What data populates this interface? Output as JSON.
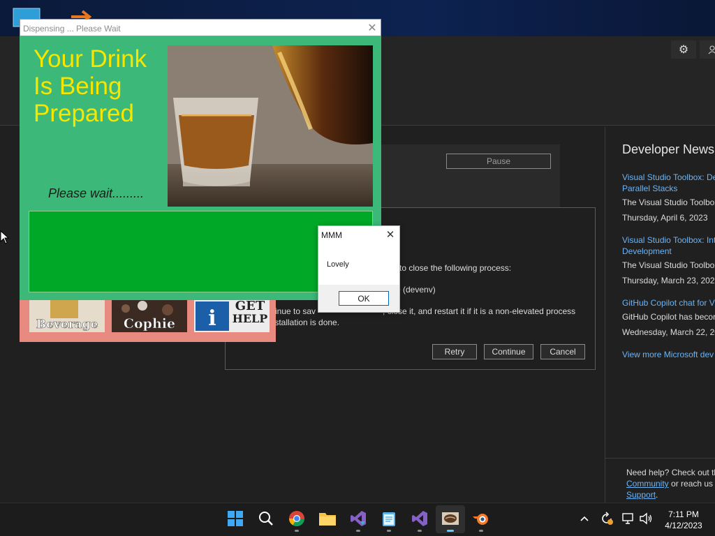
{
  "installer": {
    "pause_label": "Pause",
    "dialog": {
      "line1": "to close the following process:",
      "line2": "o (devenv)",
      "line3": "ntinue to sav",
      "line3b": ", close it, and restart it if it is a non-elevated process",
      "line4": "installation is done.",
      "retry_label": "Retry",
      "continue_label": "Continue",
      "cancel_label": "Cancel"
    },
    "news": {
      "title": "Developer News",
      "items": [
        {
          "link_line1": "Visual Studio Toolbox: De",
          "link_line2": "Parallel Stacks",
          "desc": "The Visual Studio Toolbox",
          "date": "Thursday, April 6, 2023"
        },
        {
          "link_line1": "Visual Studio Toolbox: Int",
          "link_line2": "Development",
          "desc": "The Visual Studio Toolbox",
          "date": "Thursday, March 23, 2023"
        },
        {
          "link_line1": "GitHub Copilot chat for V",
          "link_line2": "",
          "desc": "GitHub Copilot has becor",
          "date": "Wednesday, March 22, 20"
        }
      ],
      "more_link": "View more Microsoft dev"
    },
    "help": {
      "line1": "Need help? Check out th",
      "community": "Community",
      "mid": " or reach us",
      "support": "Support",
      "period": "."
    },
    "icons": {
      "settings": "gear-icon",
      "account": "person-icon"
    }
  },
  "dispense_window": {
    "title": "Dispensing ... Please Wait",
    "heading_line1": "Your Drink",
    "heading_line2": "Is Being",
    "heading_line3": "Prepared",
    "please_wait": "Please wait.........",
    "tiles": {
      "beverage": "Beverage",
      "cophie": "Cophie",
      "help_line1": "GET",
      "help_line2": "HELP",
      "info_glyph": "i"
    },
    "colors": {
      "body": "#3cb878",
      "heading": "#f7e600",
      "progress": "#00a828",
      "bottom": "#e88a80"
    }
  },
  "message_box": {
    "title": "MMM",
    "text": "Lovely",
    "ok_label": "OK"
  },
  "taskbar": {
    "time": "7:11 PM",
    "date": "4/12/2023",
    "apps": [
      "start",
      "search",
      "chrome",
      "file-explorer",
      "visual-studio-installer",
      "notepad",
      "visual-studio",
      "coffee-app",
      "blender"
    ]
  }
}
